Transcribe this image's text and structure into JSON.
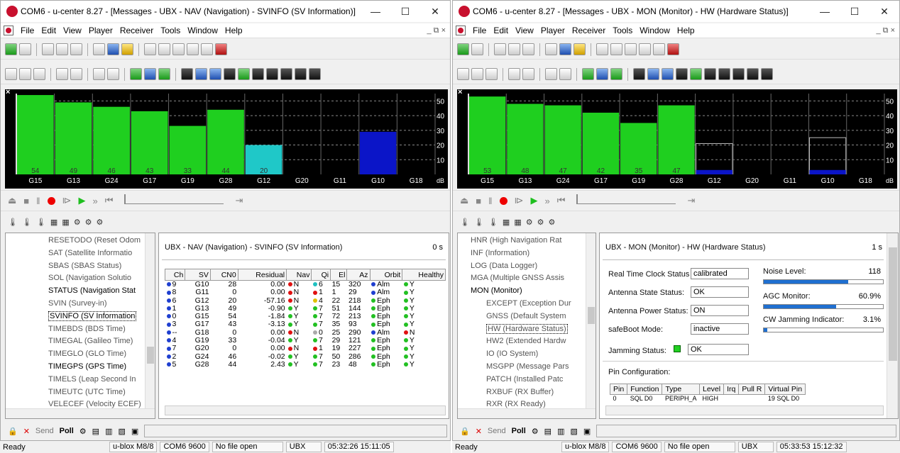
{
  "left": {
    "title": "COM6 - u-center 8.27 - [Messages - UBX - NAV (Navigation) - SVINFO (SV Information)]",
    "menu": [
      "File",
      "Edit",
      "View",
      "Player",
      "Receiver",
      "Tools",
      "Window",
      "Help"
    ],
    "chart": {
      "labels": [
        "G15",
        "G13",
        "G24",
        "G17",
        "G19",
        "G28",
        "G12",
        "G20",
        "G11",
        "G10",
        "G18"
      ],
      "values": [
        54,
        49,
        46,
        43,
        33,
        44,
        20,
        null,
        null,
        null,
        null
      ],
      "value_labels": [
        "54",
        "49",
        "46",
        "43",
        "33",
        "44",
        "20",
        "",
        "",
        "",
        ""
      ],
      "colors": [
        "green",
        "green",
        "green",
        "green",
        "green",
        "green",
        "cyan",
        "",
        "",
        "",
        ""
      ],
      "extra_bars": [
        {
          "index": 9,
          "value": 29,
          "color": "blue"
        }
      ],
      "axis_ticks": [
        "50",
        "40",
        "30",
        "20",
        "10"
      ],
      "unit": "dB"
    },
    "tree": [
      "RESETODO (Reset Odom",
      "SAT (Satellite Informatio",
      "SBAS (SBAS Status)",
      "SOL (Navigation Solutio",
      "STATUS (Navigation Stat",
      "SVIN (Survey-in)",
      "SVINFO (SV Information",
      "TIMEBDS (BDS Time)",
      "TIMEGAL (Galileo Time)",
      "TIMEGLO (GLO Time)",
      "TIMEGPS (GPS Time)",
      "TIMELS (Leap Second In",
      "TIMEUTC (UTC Time)",
      "VELECEF (Velocity ECEF)"
    ],
    "pane_title": "UBX - NAV (Navigation) - SVINFO (SV Information)",
    "pane_time": "0 s",
    "columns": [
      "Ch",
      "SV",
      "CN0",
      "Residual",
      "Nav",
      "Qi",
      "El",
      "Az",
      "Orbit",
      "Healthy"
    ],
    "rows": [
      [
        "9",
        "G10",
        "28",
        "0.00",
        "N",
        "6",
        "15",
        "320",
        "Alm",
        "Y"
      ],
      [
        "8",
        "G11",
        "0",
        "0.00",
        "N",
        "1",
        "1",
        "29",
        "Alm",
        "Y"
      ],
      [
        "6",
        "G12",
        "20",
        "-57.16",
        "N",
        "4",
        "22",
        "218",
        "Eph",
        "Y"
      ],
      [
        "1",
        "G13",
        "49",
        "-0.90",
        "Y",
        "7",
        "51",
        "144",
        "Eph",
        "Y"
      ],
      [
        "0",
        "G15",
        "54",
        "-1.84",
        "Y",
        "7",
        "72",
        "213",
        "Eph",
        "Y"
      ],
      [
        "3",
        "G17",
        "43",
        "-3.13",
        "Y",
        "7",
        "35",
        "93",
        "Eph",
        "Y"
      ],
      [
        "--",
        "G18",
        "0",
        "0.00",
        "N",
        "0",
        "25",
        "290",
        "Alm",
        "N"
      ],
      [
        "4",
        "G19",
        "33",
        "-0.04",
        "Y",
        "7",
        "29",
        "121",
        "Eph",
        "Y"
      ],
      [
        "7",
        "G20",
        "0",
        "0.00",
        "N",
        "1",
        "19",
        "227",
        "Eph",
        "Y"
      ],
      [
        "2",
        "G24",
        "46",
        "-0.02",
        "Y",
        "7",
        "50",
        "286",
        "Eph",
        "Y"
      ],
      [
        "5",
        "G28",
        "44",
        "2.43",
        "Y",
        "7",
        "23",
        "48",
        "Eph",
        "Y"
      ]
    ],
    "status": {
      "ready": "Ready",
      "device": "u-blox M8/8",
      "port": "COM6 9600",
      "file": "No file open",
      "proto": "UBX",
      "time": "05:32:26 15:11:05"
    }
  },
  "right": {
    "title": "COM6 - u-center 8.27 - [Messages - UBX - MON (Monitor) - HW (Hardware Status)]",
    "menu": [
      "File",
      "Edit",
      "View",
      "Player",
      "Receiver",
      "Tools",
      "Window",
      "Help"
    ],
    "chart": {
      "labels": [
        "G15",
        "G13",
        "G24",
        "G17",
        "G19",
        "G28",
        "G12",
        "G20",
        "G11",
        "G10",
        "G18"
      ],
      "values": [
        53,
        48,
        47,
        42,
        35,
        47,
        null,
        null,
        null,
        null,
        null
      ],
      "value_labels": [
        "53",
        "48",
        "47",
        "42",
        "35",
        "47",
        "",
        "",
        "",
        "",
        ""
      ],
      "colors": [
        "green",
        "green",
        "green",
        "green",
        "green",
        "green",
        "",
        "",
        "",
        "",
        ""
      ],
      "extra_bars": [
        {
          "index": 6,
          "value": 3,
          "color": "blue"
        },
        {
          "index": 9,
          "value": 3,
          "color": "blue"
        }
      ],
      "outline_bars": [
        {
          "index": 6,
          "value": 21
        },
        {
          "index": 9,
          "value": 25
        }
      ],
      "axis_ticks": [
        "50",
        "40",
        "30",
        "20",
        "10"
      ],
      "unit": "dB"
    },
    "tree": [
      "HNR (High Navigation Rat",
      "INF (Information)",
      "LOG (Data Logger)",
      "MGA (Multiple GNSS Assis",
      "MON (Monitor)",
      "EXCEPT (Exception Dur",
      "GNSS (Default System",
      "HW (Hardware Status)",
      "HW2 (Extended Hardw",
      "IO (IO System)",
      "MSGPP (Message Pars",
      "PATCH (Installed Patc",
      "RXBUF (RX Buffer)",
      "RXR (RX Ready)"
    ],
    "pane_title": "UBX - MON (Monitor) - HW (Hardware Status)",
    "pane_time": "1 s",
    "hw": {
      "rtc_label": "Real Time Clock Status",
      "rtc_value": "calibrated",
      "ant_state_label": "Antenna State Status:",
      "ant_state_value": "OK",
      "ant_power_label": "Antenna Power Status:",
      "ant_power_value": "ON",
      "safeboot_label": "safeBoot Mode:",
      "safeboot_value": "inactive",
      "jamming_label": "Jamming Status:",
      "jamming_value": "OK",
      "noise_label": "Noise Level:",
      "noise_value": "118",
      "noise_fraction": 0.71,
      "agc_label": "AGC Monitor:",
      "agc_value": "60.9%",
      "agc_fraction": 0.609,
      "cw_label": "CW Jamming Indicator:",
      "cw_value": "3.1%",
      "cw_fraction": 0.031,
      "pin_label": "Pin Configuration:",
      "pin_cols": [
        "Pin",
        "Function",
        "Type",
        "Level",
        "Irq",
        "Pull R",
        "Virtual Pin"
      ],
      "pin_row": [
        "0",
        "SQL D0",
        "PERIPH_A",
        "HIGH",
        "",
        "",
        "19  SQL D0"
      ]
    },
    "status": {
      "ready": "Ready",
      "device": "u-blox M8/8",
      "port": "COM6 9600",
      "file": "No file open",
      "proto": "UBX",
      "time": "05:33:53 15:12:32"
    }
  },
  "common": {
    "send_label": "Send",
    "poll_label": "Poll",
    "mdi_controls": "_  ⧉  ×",
    "minimize_glyph": "—",
    "maximize_glyph": "☐",
    "close_glyph": "✕"
  }
}
